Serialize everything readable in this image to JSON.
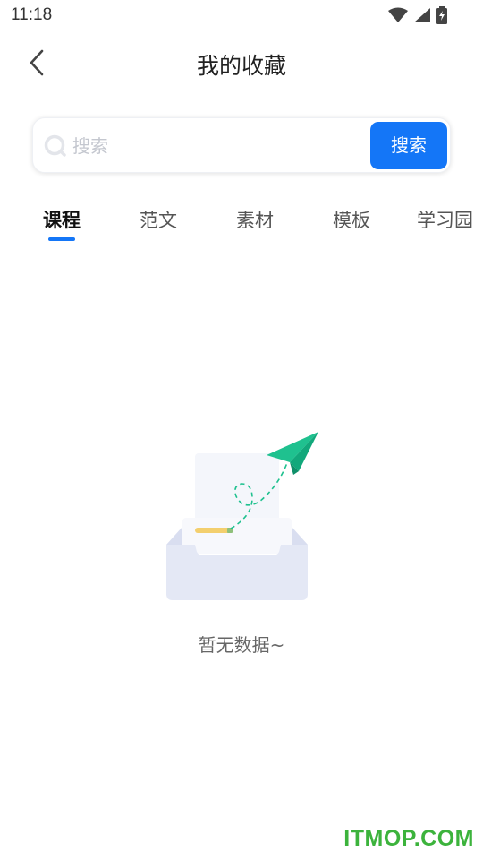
{
  "status_bar": {
    "time": "11:18",
    "icons": [
      "wifi-icon",
      "cellular-signal-icon",
      "battery-charging-icon"
    ]
  },
  "header": {
    "title": "我的收藏",
    "back_icon": "chevron-left-icon"
  },
  "search": {
    "placeholder": "搜索",
    "value": "",
    "button_label": "搜索",
    "icon": "search-icon"
  },
  "tabs": [
    {
      "label": "课程",
      "active": true
    },
    {
      "label": "范文",
      "active": false
    },
    {
      "label": "素材",
      "active": false
    },
    {
      "label": "模板",
      "active": false
    },
    {
      "label": "学习园",
      "active": false
    }
  ],
  "empty_state": {
    "message": "暂无数据~",
    "illustration": "empty-inbox-paper-plane-illustration"
  },
  "watermark": {
    "text": "ITMOP.COM"
  },
  "colors": {
    "accent": "#1476f7",
    "plane": "#1fc18f",
    "watermark": "#3cb33c"
  }
}
